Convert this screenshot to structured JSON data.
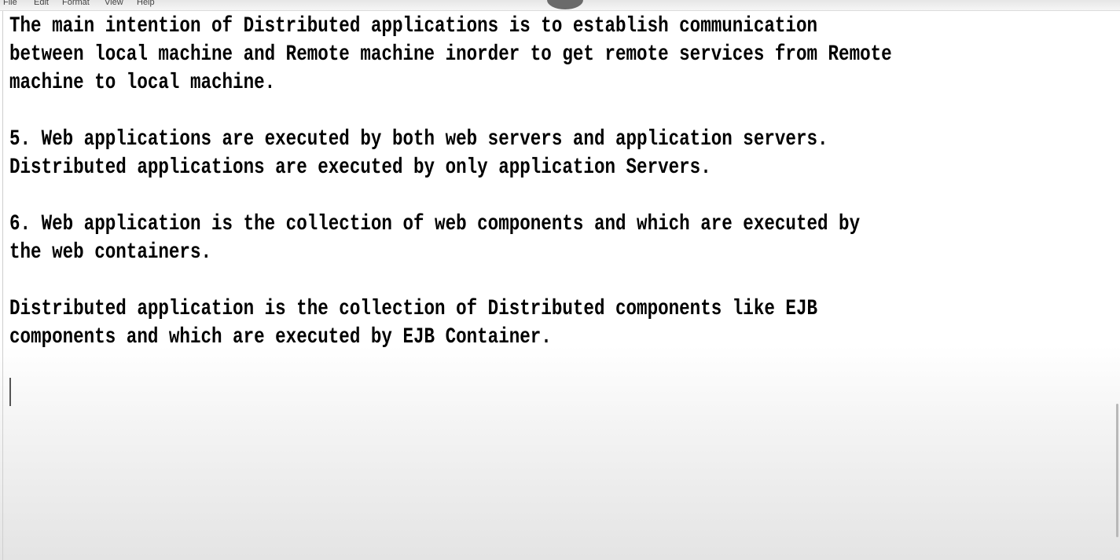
{
  "menu": {
    "items": [
      "File",
      "Edit",
      "Format",
      "View",
      "Help"
    ]
  },
  "document": {
    "lines": [
      "The main intention of Distributed applications is to establish communication",
      "between local machine and Remote machine inorder to get remote services from Remote",
      "machine to local machine.",
      "",
      "5. Web applications are executed by both web servers and application servers.",
      "Distributed applications are executed by only application Servers.",
      "",
      "6. Web application is the collection of web components and which are executed by",
      "the web containers.",
      "",
      "Distributed application is the collection of Distributed components like EJB",
      "components and which are executed by EJB Container."
    ]
  }
}
